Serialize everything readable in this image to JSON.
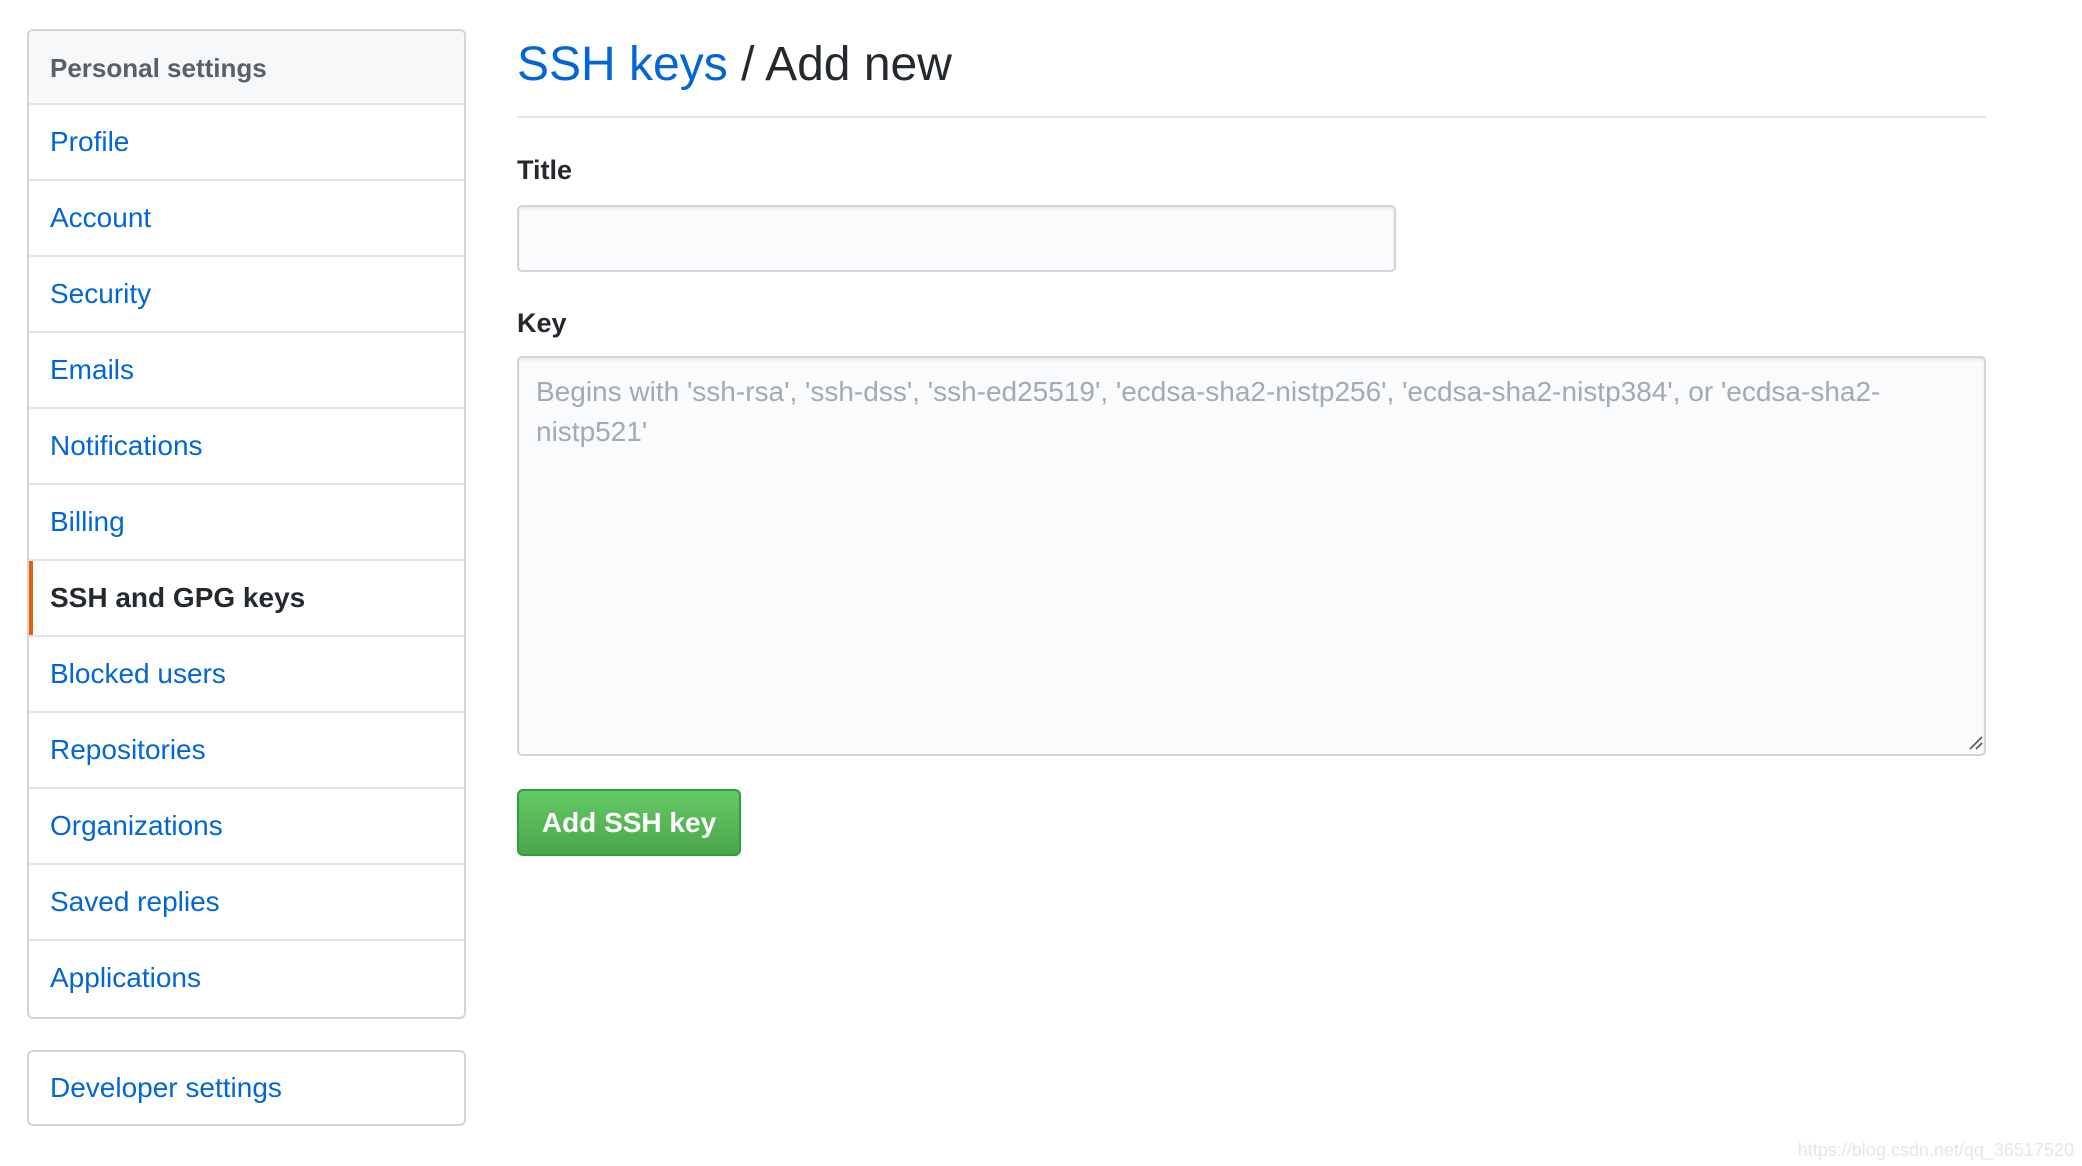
{
  "sidebar": {
    "heading": "Personal settings",
    "items": [
      {
        "label": "Profile",
        "selected": false
      },
      {
        "label": "Account",
        "selected": false
      },
      {
        "label": "Security",
        "selected": false
      },
      {
        "label": "Emails",
        "selected": false
      },
      {
        "label": "Notifications",
        "selected": false
      },
      {
        "label": "Billing",
        "selected": false
      },
      {
        "label": "SSH and GPG keys",
        "selected": true
      },
      {
        "label": "Blocked users",
        "selected": false
      },
      {
        "label": "Repositories",
        "selected": false
      },
      {
        "label": "Organizations",
        "selected": false
      },
      {
        "label": "Saved replies",
        "selected": false
      },
      {
        "label": "Applications",
        "selected": false
      }
    ],
    "developer_settings": "Developer settings"
  },
  "header": {
    "breadcrumb_link": "SSH keys",
    "separator": " / ",
    "title": "Add new"
  },
  "form": {
    "title_label": "Title",
    "title_value": "",
    "key_label": "Key",
    "key_value": "",
    "key_placeholder": "Begins with 'ssh-rsa', 'ssh-dss', 'ssh-ed25519', 'ecdsa-sha2-nistp256', 'ecdsa-sha2-nistp384', or 'ecdsa-sha2-nistp521'",
    "submit_label": "Add SSH key"
  },
  "colors": {
    "link": "#0366d6",
    "selected_indicator": "#e36209",
    "primary_button": "#4ba64b"
  },
  "watermark": "https://blog.csdn.net/qq_36517520"
}
